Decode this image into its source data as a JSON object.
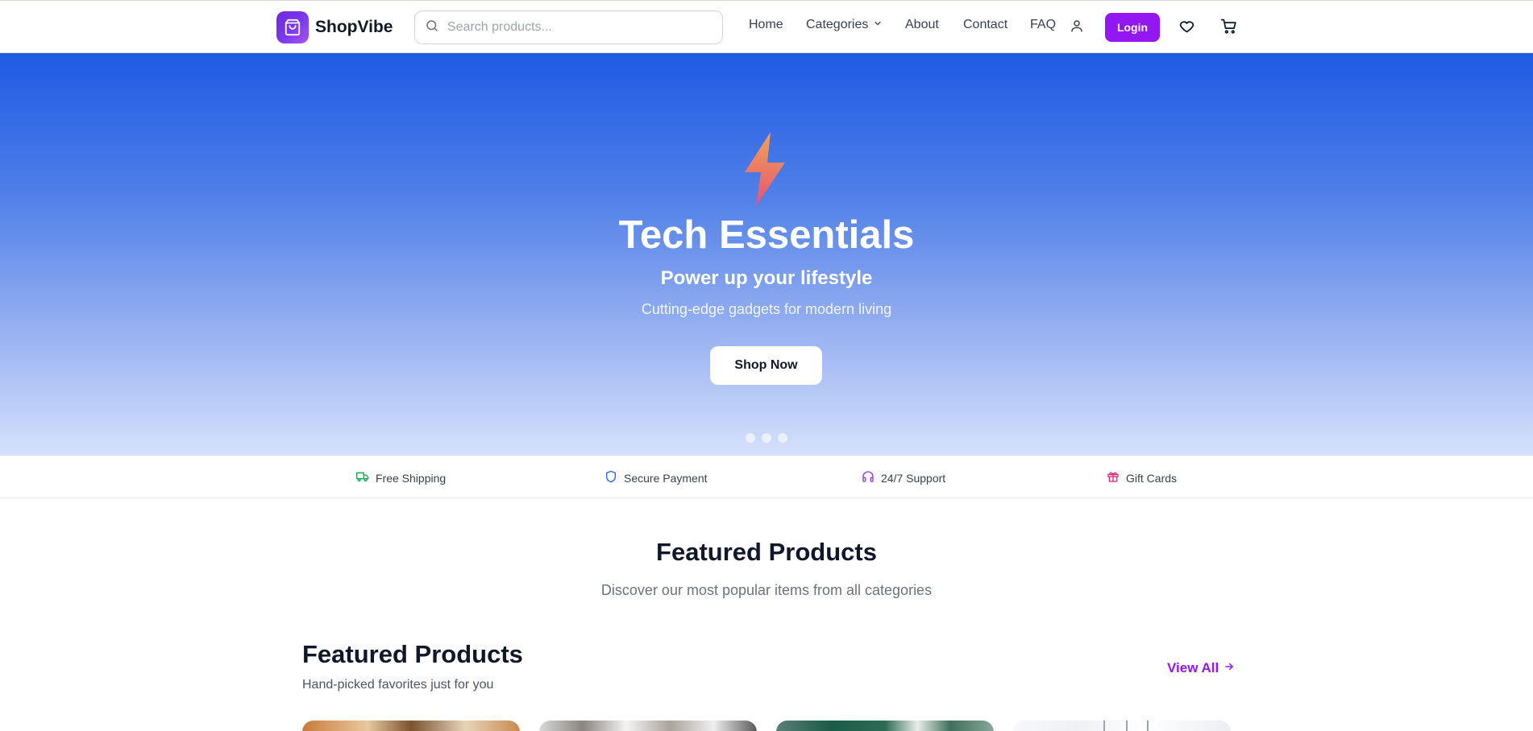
{
  "brand": {
    "name": "ShopVibe",
    "accent": "#9317f0"
  },
  "search": {
    "placeholder": "Search products..."
  },
  "nav": {
    "home": "Home",
    "categories": "Categories",
    "about": "About",
    "contact": "Contact",
    "faq": "FAQ",
    "login": "Login",
    "icons": [
      "user-icon",
      "heart-icon",
      "cart-icon"
    ]
  },
  "hero": {
    "title": "Tech Essentials",
    "subtitle": "Power up your lifestyle",
    "description": "Cutting-edge gadgets for modern living",
    "cta": "Shop Now",
    "slide_count": 3,
    "icon": "lightning-bolt-icon"
  },
  "features": [
    {
      "label": "Free Shipping",
      "icon": "truck-icon",
      "color": "#16a34a"
    },
    {
      "label": "Secure Payment",
      "icon": "shield-icon",
      "color": "#2563eb"
    },
    {
      "label": "24/7 Support",
      "icon": "headphones-icon",
      "color": "#9333ea"
    },
    {
      "label": "Gift Cards",
      "icon": "gift-icon",
      "color": "#db2777"
    }
  ],
  "featured_section": {
    "title": "Featured Products",
    "subtitle": "Discover our most popular items from all categories"
  },
  "featured_products": {
    "title": "Featured Products",
    "subtitle": "Hand-picked favorites just for you",
    "view_all": "View All"
  }
}
